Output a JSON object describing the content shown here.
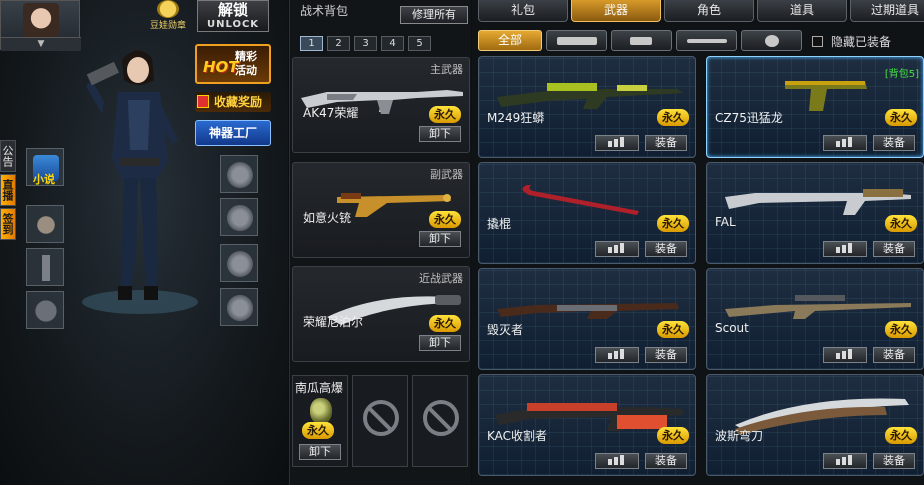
{
  "left": {
    "avatar_toggle": "▼",
    "badge_label": "豆娃勋章",
    "unlock": {
      "cn": "解锁",
      "en": "UNLOCK"
    },
    "promo_hot": {
      "hot": "HOT",
      "line1": "精彩",
      "line2": "活动"
    },
    "promo_collect": "收藏奖励",
    "promo_factory": "神器工厂",
    "side_tabs": [
      "公告",
      "直播",
      "签到"
    ],
    "slot_novel_label": "小说"
  },
  "backpack": {
    "title": "战术背包",
    "repair_label": "修理所有",
    "pages": [
      "1",
      "2",
      "3",
      "4",
      "5"
    ],
    "primary": {
      "category": "主武器",
      "name": "AK47荣耀",
      "tag": "永久",
      "unload": "卸下"
    },
    "secondary": {
      "category": "副武器",
      "name": "如意火铳",
      "tag": "永久",
      "unload": "卸下"
    },
    "melee": {
      "category": "近战武器",
      "name": "荣耀尼泊尔",
      "tag": "永久",
      "unload": "卸下"
    },
    "grenade": {
      "name": "南瓜高爆",
      "tag": "永久",
      "unload": "卸下"
    }
  },
  "shop": {
    "tabs": [
      "礼包",
      "武器",
      "角色",
      "道具",
      "过期道具"
    ],
    "filter_all": "全部",
    "hide_equipped": "隐藏已装备",
    "perm": "永久",
    "equip": "装备",
    "items": [
      {
        "name": "M249狂蟒",
        "bag": ""
      },
      {
        "name": "CZ75迅猛龙",
        "bag": "[背包5]"
      },
      {
        "name": "撬棍",
        "bag": ""
      },
      {
        "name": "FAL",
        "bag": ""
      },
      {
        "name": "毁灭者",
        "bag": ""
      },
      {
        "name": "Scout",
        "bag": ""
      },
      {
        "name": "KAC收割者",
        "bag": ""
      },
      {
        "name": "波斯弯刀",
        "bag": ""
      }
    ]
  },
  "colors": {
    "accent": "#e5a932",
    "perm_tag": "#ffd21e",
    "panel_blue": "#1a2b3d",
    "bag_green": "#44e044"
  }
}
